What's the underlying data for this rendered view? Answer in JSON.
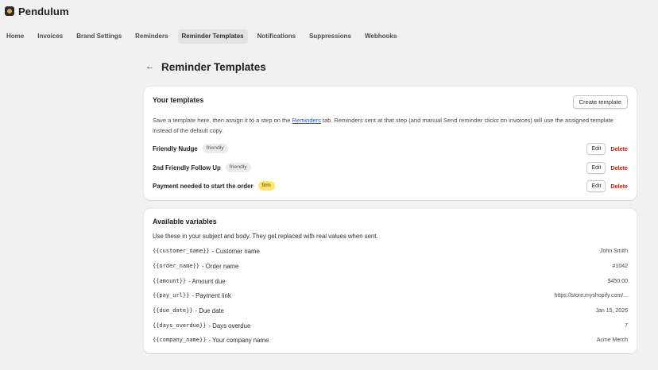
{
  "app": {
    "name": "Pendulum"
  },
  "nav": [
    {
      "label": "Home",
      "active": false
    },
    {
      "label": "Invoices",
      "active": false
    },
    {
      "label": "Brand Settings",
      "active": false
    },
    {
      "label": "Reminders",
      "active": false
    },
    {
      "label": "Reminder Templates",
      "active": true
    },
    {
      "label": "Notifications",
      "active": false
    },
    {
      "label": "Suppressions",
      "active": false
    },
    {
      "label": "Webhooks",
      "active": false
    }
  ],
  "page": {
    "back_icon": "arrow-left-icon",
    "title": "Reminder Templates"
  },
  "templates_card": {
    "title": "Your templates",
    "create_label": "Create template",
    "desc_before": "Save a template here, then assign it to a step on the ",
    "desc_link": "Reminders",
    "desc_after": " tab. Reminders sent at that step (and manual Send reminder clicks on invoices) will use the assigned template instead of the default copy.",
    "edit_label": "Edit",
    "delete_label": "Delete",
    "items": [
      {
        "name": "Friendly Nudge",
        "tag": "friendly"
      },
      {
        "name": "2nd Friendly Follow Up",
        "tag": "friendly"
      },
      {
        "name": "Payment needed to start the order",
        "tag": "firm"
      }
    ]
  },
  "variables_card": {
    "title": "Available variables",
    "intro": "Use these in your subject and body. They get replaced with real values when sent.",
    "items": [
      {
        "code": "{{customer_name}}",
        "label": "- Customer name",
        "example": "John Smith"
      },
      {
        "code": "{{order_name}}",
        "label": "- Order name",
        "example": "#1042"
      },
      {
        "code": "{{amount}}",
        "label": "- Amount due",
        "example": "$450.00"
      },
      {
        "code": "{{pay_url}}",
        "label": "- Payment link",
        "example": "https://store.myshopify.com/..."
      },
      {
        "code": "{{due_date}}",
        "label": "- Due date",
        "example": "Jan 15, 2026"
      },
      {
        "code": "{{days_overdue}}",
        "label": "- Days overdue",
        "example": "7"
      },
      {
        "code": "{{company_name}}",
        "label": "- Your company name",
        "example": "Acme Merch"
      }
    ]
  },
  "colors": {
    "background": "#f1f1f1",
    "card": "#ffffff",
    "link": "#2456c7",
    "delete": "#b42318",
    "firm_badge": "#ffe66b",
    "default_badge": "#ececec"
  }
}
